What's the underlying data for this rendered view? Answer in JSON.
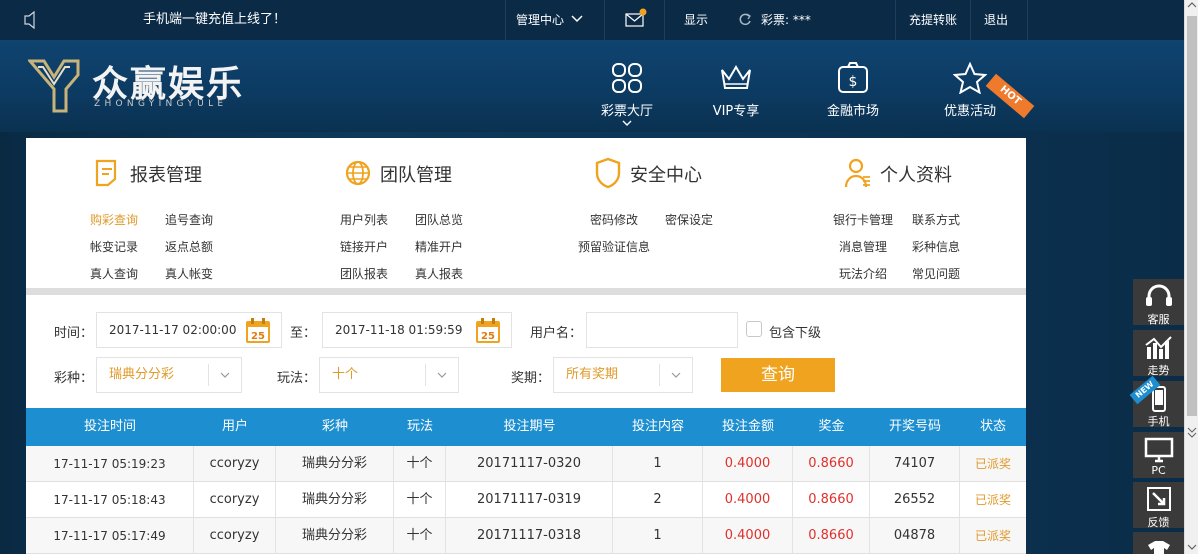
{
  "topbar": {
    "announcement": "手机端一键充值上线了！",
    "manage_center": "管理中心",
    "show": "显示",
    "lottery_label": "彩票: ***",
    "deposit_transfer": "充提转账",
    "logout": "退出"
  },
  "header": {
    "logo_title": "众赢娱乐",
    "logo_sub": "ZHONGYINGYULE",
    "nav": [
      {
        "label": "彩票大厅",
        "icon": "grid-icon"
      },
      {
        "label": "VIP专享",
        "icon": "crown-icon"
      },
      {
        "label": "金融市场",
        "icon": "money-bag-icon"
      },
      {
        "label": "优惠活动",
        "icon": "star-icon"
      }
    ],
    "hot_badge": "HOT"
  },
  "menu": {
    "report": {
      "title": "报表管理",
      "icon": "document-icon",
      "links": [
        "购彩查询",
        "追号查询",
        "帐变记录",
        "返点总额",
        "真人查询",
        "真人帐变"
      ]
    },
    "team": {
      "title": "团队管理",
      "icon": "globe-icon",
      "links": [
        "用户列表",
        "团队总览",
        "链接开户",
        "精准开户",
        "团队报表",
        "真人报表"
      ]
    },
    "security": {
      "title": "安全中心",
      "icon": "shield-icon",
      "links": [
        "密码修改",
        "密保设定",
        "预留验证信息"
      ]
    },
    "profile": {
      "title": "个人资料",
      "icon": "user-icon",
      "links": [
        "银行卡管理",
        "联系方式",
        "消息管理",
        "彩种信息",
        "玩法介绍",
        "常见问题"
      ]
    }
  },
  "filters": {
    "time_label": "时间：",
    "start_time": "2017-11-17 02:00:00",
    "to_label": "至：",
    "end_time": "2017-11-18 01:59:59",
    "calendar_day": "25",
    "username_label": "用户名：",
    "username_value": "",
    "include_sub_label": "包含下级",
    "lottery_label": "彩种：",
    "lottery_value": "瑞典分分彩",
    "play_label": "玩法：",
    "play_value": "十个",
    "period_label": "奖期：",
    "period_value": "所有奖期",
    "query_button": "查询"
  },
  "table": {
    "headers": [
      "投注时间",
      "用户",
      "彩种",
      "玩法",
      "投注期号",
      "投注内容",
      "投注金额",
      "奖金",
      "开奖号码",
      "状态"
    ],
    "rows": [
      [
        "17-11-17 05:19:23",
        "ccoryzy",
        "瑞典分分彩",
        "十个",
        "20171117-0320",
        "1",
        "0.4000",
        "0.8660",
        "74107",
        "已派奖"
      ],
      [
        "17-11-17 05:18:43",
        "ccoryzy",
        "瑞典分分彩",
        "十个",
        "20171117-0319",
        "2",
        "0.4000",
        "0.8660",
        "26552",
        "已派奖"
      ],
      [
        "17-11-17 05:17:49",
        "ccoryzy",
        "瑞典分分彩",
        "十个",
        "20171117-0318",
        "1",
        "0.4000",
        "0.8660",
        "04878",
        "已派奖"
      ]
    ]
  },
  "sidebar": {
    "items": [
      {
        "label": "客服",
        "icon": "headset-icon"
      },
      {
        "label": "走势",
        "icon": "trend-icon"
      },
      {
        "label": "手机",
        "icon": "phone-icon"
      },
      {
        "label": "PC",
        "icon": "monitor-icon"
      },
      {
        "label": "反馈",
        "icon": "feedback-icon"
      }
    ],
    "new_badge": "NEW"
  },
  "colors": {
    "accent": "#f0a31f",
    "table_header": "#1d8fd1",
    "money_red": "#e0312c",
    "link_orange": "#e09a2a"
  }
}
